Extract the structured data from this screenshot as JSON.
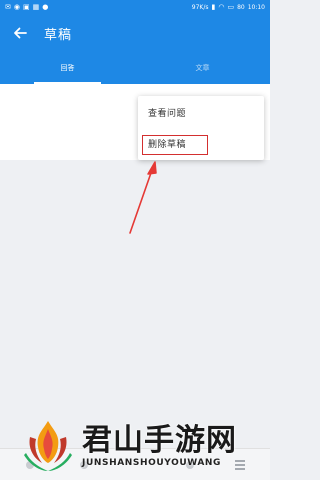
{
  "status_bar": {
    "network_speed": "97K/s",
    "battery": "80",
    "time": "10:10"
  },
  "header": {
    "title": "草稿",
    "back_icon": "arrow-left-icon"
  },
  "tabs": [
    {
      "label": "回答",
      "active": true
    },
    {
      "label": "文章",
      "active": false
    }
  ],
  "menu": {
    "items": [
      {
        "label": "查看问题"
      },
      {
        "label": "删除草稿"
      }
    ],
    "highlighted_index": 1
  },
  "colors": {
    "primary": "#1e88e5",
    "highlight": "#d32f2f",
    "arrow": "#e53935"
  },
  "watermark": {
    "title": "君山手游网",
    "subtitle": "JUNSHANSHOUYOUWANG"
  }
}
